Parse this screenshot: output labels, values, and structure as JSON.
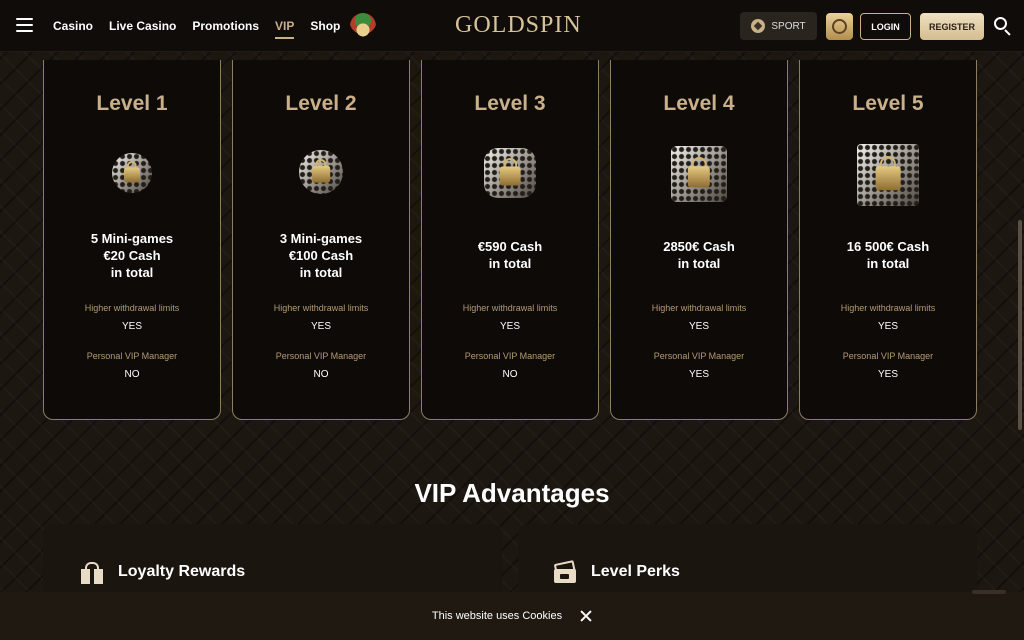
{
  "header": {
    "nav": [
      {
        "label": "Casino"
      },
      {
        "label": "Live Casino"
      },
      {
        "label": "Promotions"
      },
      {
        "label": "VIP",
        "active": true
      },
      {
        "label": "Shop"
      }
    ],
    "logo": "GOLDSPIN",
    "sport_label": "SPORT",
    "login_label": "LOGIN",
    "register_label": "REGISTER"
  },
  "levels": [
    {
      "title": "Level 1",
      "prize": "5 Mini-games\n€20 Cash\nin total",
      "withdrawal_label": "Higher withdrawal limits",
      "withdrawal_value": "YES",
      "manager_label": "Personal VIP Manager",
      "manager_value": "NO"
    },
    {
      "title": "Level 2",
      "prize": "3 Mini-games\n€100 Cash\nin total",
      "withdrawal_label": "Higher withdrawal limits",
      "withdrawal_value": "YES",
      "manager_label": "Personal VIP Manager",
      "manager_value": "NO"
    },
    {
      "title": "Level 3",
      "prize": "€590 Cash\nin total",
      "withdrawal_label": "Higher withdrawal limits",
      "withdrawal_value": "YES",
      "manager_label": "Personal VIP Manager",
      "manager_value": "NO"
    },
    {
      "title": "Level 4",
      "prize": "2850€ Cash\nin total",
      "withdrawal_label": "Higher withdrawal limits",
      "withdrawal_value": "YES",
      "manager_label": "Personal VIP Manager",
      "manager_value": "YES"
    },
    {
      "title": "Level 5",
      "prize": "16 500€ Cash\nin total",
      "withdrawal_label": "Higher withdrawal limits",
      "withdrawal_value": "YES",
      "manager_label": "Personal VIP Manager",
      "manager_value": "YES"
    }
  ],
  "advantages": {
    "title": "VIP Advantages",
    "items": [
      {
        "label": "Loyalty Rewards",
        "icon": "gift-icon"
      },
      {
        "label": "Level Perks",
        "icon": "card-icon"
      }
    ]
  },
  "cookie": {
    "text": "This website uses Cookies"
  },
  "colors": {
    "accent": "#c9b089",
    "background": "#1d1712",
    "card": "#0d0a08"
  }
}
